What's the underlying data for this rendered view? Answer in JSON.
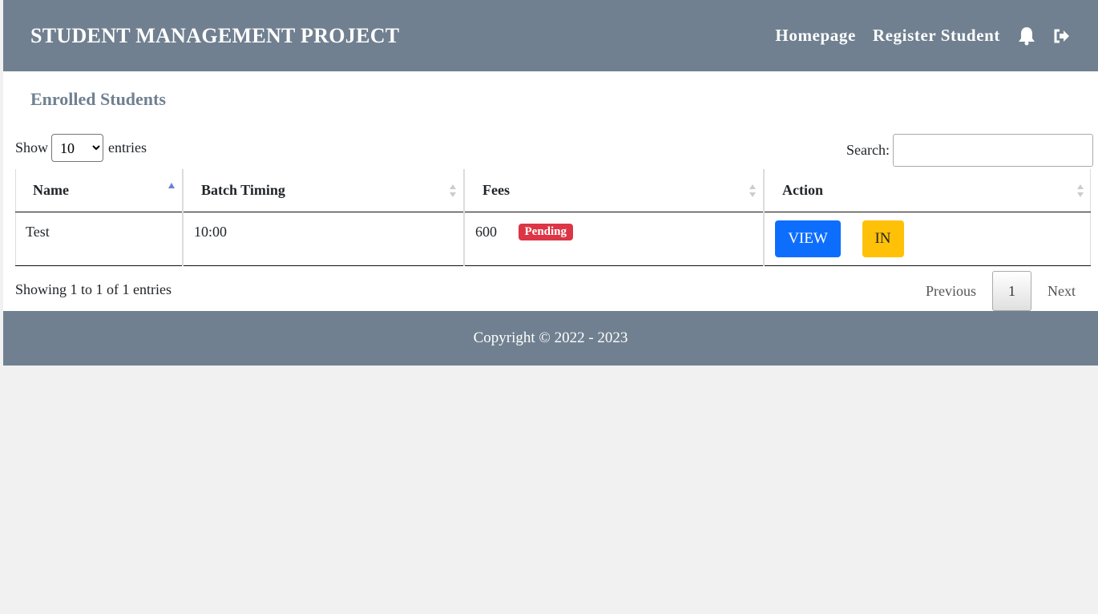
{
  "header": {
    "brand": "STUDENT MANAGEMENT PROJECT",
    "nav": [
      "Homepage",
      "Register Student"
    ],
    "icons": [
      "bell-icon",
      "sign-out-icon"
    ]
  },
  "main": {
    "title": "Enrolled Students",
    "length": {
      "show": "Show",
      "value": "10",
      "options": [
        "10"
      ],
      "entries": "entries"
    },
    "search": {
      "label": "Search:",
      "value": ""
    },
    "table": {
      "columns": [
        "Name",
        "Batch Timing",
        "Fees",
        "Action"
      ],
      "rows": [
        {
          "name": "Test",
          "batch": "10:00",
          "fees": "600",
          "status": "Pending",
          "view": "VIEW",
          "in": "IN"
        }
      ]
    },
    "info": "Showing 1 to 1 of 1 entries",
    "pagination": {
      "previous": "Previous",
      "current": "1",
      "next": "Next"
    }
  },
  "footer": {
    "copyright": "Copyright © 2022 - 2023"
  },
  "colors": {
    "header": "#708090",
    "badge": "#dc3545",
    "view": "#0d6efd",
    "in": "#ffc107",
    "sortActive": "#6a7fd6"
  }
}
